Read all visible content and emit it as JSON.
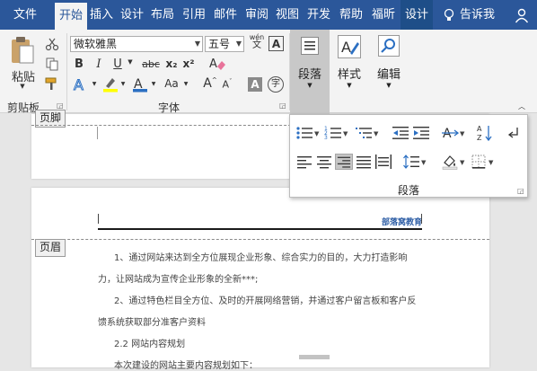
{
  "tabs": [
    "文件",
    "开始",
    "插入",
    "设计",
    "布局",
    "引用",
    "邮件",
    "审阅",
    "视图",
    "开发",
    "帮助",
    "福昕",
    "设计"
  ],
  "tell_me": "告诉我",
  "clipboard": {
    "paste_label": "粘贴",
    "group_label": "剪贴板"
  },
  "font": {
    "name": "微软雅黑",
    "size": "五号",
    "group_label": "字体",
    "bold": "B",
    "italic": "I",
    "underline": "U",
    "strike": "abc",
    "sub": "x₂",
    "sup": "x²",
    "wen": "wén",
    "case": "Aa",
    "grow": "A",
    "shrink": "A",
    "char_border": "A",
    "enclose": "字"
  },
  "big_buttons": {
    "paragraph": "段落",
    "styles": "样式",
    "editing": "编辑"
  },
  "paragraph_panel": {
    "label": "段落"
  },
  "header_tag_top": "页脚",
  "header_tag": "页眉",
  "header_brand": "部落窝教育",
  "body_lines": [
    "1、通过网站来达到全方位展现企业形象、综合实力的目的，大力打造影响",
    "力，让网站成为宣传企业形象的全新***;",
    "2、通过特色栏目全方位、及时的开展网络营销，并通过客户留言板和客户反",
    "馈系统获取部分准客户资料",
    "2.2 网站内容规划",
    "本次建设的网站主要内容规划如下："
  ],
  "colors": {
    "brand_blue": "#2b579a",
    "ribbon_bg": "#f3f3f3",
    "header_brand": "#2f5fa6"
  }
}
